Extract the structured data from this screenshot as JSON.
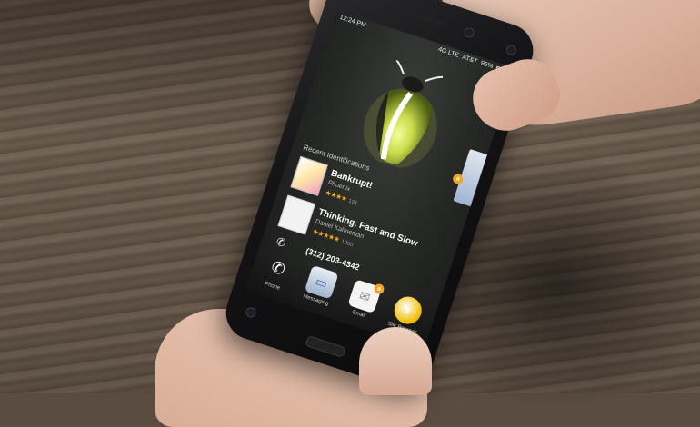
{
  "status_bar": {
    "time": "12:24 PM",
    "network": "4G LTE",
    "carrier": "AT&T",
    "battery": "96%"
  },
  "recent": {
    "heading": "Recent Identifications",
    "items": [
      {
        "title": "Bankrupt!",
        "author": "Phoenix",
        "stars": "★★★★",
        "count": "101"
      },
      {
        "title": "Thinking, Fast and Slow",
        "author": "Daniel Kahneman",
        "stars": "★★★★★",
        "count": "1060"
      }
    ],
    "phone_number": "(312) 203-4342"
  },
  "dock": [
    {
      "label": "Phone",
      "icon": "phone-icon"
    },
    {
      "label": "Messaging",
      "icon": "messaging-icon"
    },
    {
      "label": "Email",
      "icon": "email-icon"
    },
    {
      "label": "Silk Browser",
      "icon": "silk-browser-icon"
    }
  ],
  "colors": {
    "firefly_glow": "#c8d94a",
    "star": "#f7a21b",
    "badge": "#f2a41c"
  }
}
